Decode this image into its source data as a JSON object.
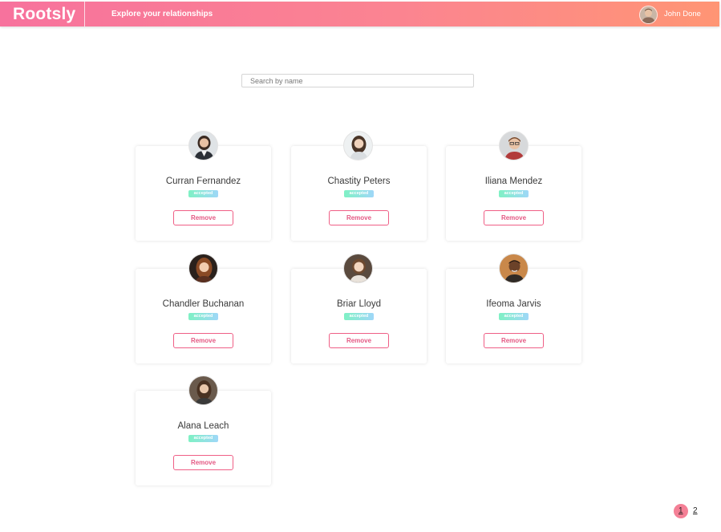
{
  "header": {
    "brand": "Rootsly",
    "tagline": "Explore your relationships",
    "user_name": "John Done"
  },
  "search": {
    "placeholder": "Search by name"
  },
  "cards": [
    {
      "name": "Curran Fernandez",
      "status": "accepted",
      "action": "Remove"
    },
    {
      "name": "Chastity Peters",
      "status": "accepted",
      "action": "Remove"
    },
    {
      "name": "Iliana Mendez",
      "status": "accepted",
      "action": "Remove"
    },
    {
      "name": "Chandler Buchanan",
      "status": "accepted",
      "action": "Remove"
    },
    {
      "name": "Briar Lloyd",
      "status": "accepted",
      "action": "Remove"
    },
    {
      "name": "Ifeoma Jarvis",
      "status": "accepted",
      "action": "Remove"
    },
    {
      "name": "Alana Leach",
      "status": "accepted",
      "action": "Remove"
    }
  ],
  "pagination": {
    "pages": [
      "1",
      "2"
    ],
    "current": "1"
  },
  "colors": {
    "header_gradient_start": "#f7729d",
    "header_gradient_end": "#ff9574",
    "accent": "#ef5f86",
    "badge_start": "#7ff1c4",
    "badge_end": "#9fd7f8"
  }
}
